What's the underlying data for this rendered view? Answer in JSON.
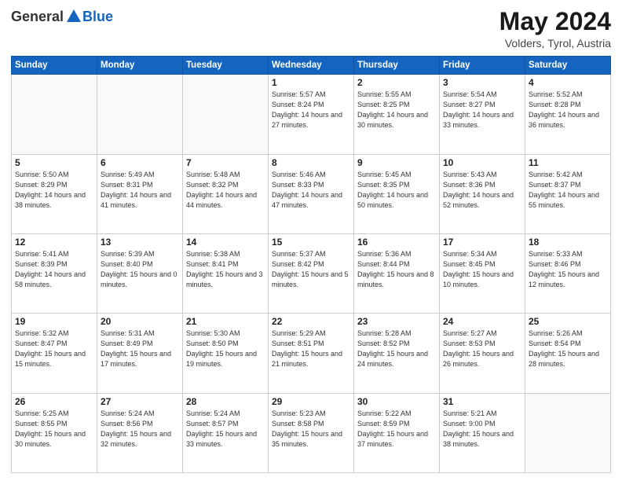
{
  "header": {
    "logo": {
      "general": "General",
      "blue": "Blue"
    },
    "month": "May 2024",
    "location": "Volders, Tyrol, Austria"
  },
  "weekdays": [
    "Sunday",
    "Monday",
    "Tuesday",
    "Wednesday",
    "Thursday",
    "Friday",
    "Saturday"
  ],
  "weeks": [
    [
      {
        "day": "",
        "sunrise": "",
        "sunset": "",
        "daylight": ""
      },
      {
        "day": "",
        "sunrise": "",
        "sunset": "",
        "daylight": ""
      },
      {
        "day": "",
        "sunrise": "",
        "sunset": "",
        "daylight": ""
      },
      {
        "day": "1",
        "sunrise": "Sunrise: 5:57 AM",
        "sunset": "Sunset: 8:24 PM",
        "daylight": "Daylight: 14 hours and 27 minutes."
      },
      {
        "day": "2",
        "sunrise": "Sunrise: 5:55 AM",
        "sunset": "Sunset: 8:25 PM",
        "daylight": "Daylight: 14 hours and 30 minutes."
      },
      {
        "day": "3",
        "sunrise": "Sunrise: 5:54 AM",
        "sunset": "Sunset: 8:27 PM",
        "daylight": "Daylight: 14 hours and 33 minutes."
      },
      {
        "day": "4",
        "sunrise": "Sunrise: 5:52 AM",
        "sunset": "Sunset: 8:28 PM",
        "daylight": "Daylight: 14 hours and 36 minutes."
      }
    ],
    [
      {
        "day": "5",
        "sunrise": "Sunrise: 5:50 AM",
        "sunset": "Sunset: 8:29 PM",
        "daylight": "Daylight: 14 hours and 38 minutes."
      },
      {
        "day": "6",
        "sunrise": "Sunrise: 5:49 AM",
        "sunset": "Sunset: 8:31 PM",
        "daylight": "Daylight: 14 hours and 41 minutes."
      },
      {
        "day": "7",
        "sunrise": "Sunrise: 5:48 AM",
        "sunset": "Sunset: 8:32 PM",
        "daylight": "Daylight: 14 hours and 44 minutes."
      },
      {
        "day": "8",
        "sunrise": "Sunrise: 5:46 AM",
        "sunset": "Sunset: 8:33 PM",
        "daylight": "Daylight: 14 hours and 47 minutes."
      },
      {
        "day": "9",
        "sunrise": "Sunrise: 5:45 AM",
        "sunset": "Sunset: 8:35 PM",
        "daylight": "Daylight: 14 hours and 50 minutes."
      },
      {
        "day": "10",
        "sunrise": "Sunrise: 5:43 AM",
        "sunset": "Sunset: 8:36 PM",
        "daylight": "Daylight: 14 hours and 52 minutes."
      },
      {
        "day": "11",
        "sunrise": "Sunrise: 5:42 AM",
        "sunset": "Sunset: 8:37 PM",
        "daylight": "Daylight: 14 hours and 55 minutes."
      }
    ],
    [
      {
        "day": "12",
        "sunrise": "Sunrise: 5:41 AM",
        "sunset": "Sunset: 8:39 PM",
        "daylight": "Daylight: 14 hours and 58 minutes."
      },
      {
        "day": "13",
        "sunrise": "Sunrise: 5:39 AM",
        "sunset": "Sunset: 8:40 PM",
        "daylight": "Daylight: 15 hours and 0 minutes."
      },
      {
        "day": "14",
        "sunrise": "Sunrise: 5:38 AM",
        "sunset": "Sunset: 8:41 PM",
        "daylight": "Daylight: 15 hours and 3 minutes."
      },
      {
        "day": "15",
        "sunrise": "Sunrise: 5:37 AM",
        "sunset": "Sunset: 8:42 PM",
        "daylight": "Daylight: 15 hours and 5 minutes."
      },
      {
        "day": "16",
        "sunrise": "Sunrise: 5:36 AM",
        "sunset": "Sunset: 8:44 PM",
        "daylight": "Daylight: 15 hours and 8 minutes."
      },
      {
        "day": "17",
        "sunrise": "Sunrise: 5:34 AM",
        "sunset": "Sunset: 8:45 PM",
        "daylight": "Daylight: 15 hours and 10 minutes."
      },
      {
        "day": "18",
        "sunrise": "Sunrise: 5:33 AM",
        "sunset": "Sunset: 8:46 PM",
        "daylight": "Daylight: 15 hours and 12 minutes."
      }
    ],
    [
      {
        "day": "19",
        "sunrise": "Sunrise: 5:32 AM",
        "sunset": "Sunset: 8:47 PM",
        "daylight": "Daylight: 15 hours and 15 minutes."
      },
      {
        "day": "20",
        "sunrise": "Sunrise: 5:31 AM",
        "sunset": "Sunset: 8:49 PM",
        "daylight": "Daylight: 15 hours and 17 minutes."
      },
      {
        "day": "21",
        "sunrise": "Sunrise: 5:30 AM",
        "sunset": "Sunset: 8:50 PM",
        "daylight": "Daylight: 15 hours and 19 minutes."
      },
      {
        "day": "22",
        "sunrise": "Sunrise: 5:29 AM",
        "sunset": "Sunset: 8:51 PM",
        "daylight": "Daylight: 15 hours and 21 minutes."
      },
      {
        "day": "23",
        "sunrise": "Sunrise: 5:28 AM",
        "sunset": "Sunset: 8:52 PM",
        "daylight": "Daylight: 15 hours and 24 minutes."
      },
      {
        "day": "24",
        "sunrise": "Sunrise: 5:27 AM",
        "sunset": "Sunset: 8:53 PM",
        "daylight": "Daylight: 15 hours and 26 minutes."
      },
      {
        "day": "25",
        "sunrise": "Sunrise: 5:26 AM",
        "sunset": "Sunset: 8:54 PM",
        "daylight": "Daylight: 15 hours and 28 minutes."
      }
    ],
    [
      {
        "day": "26",
        "sunrise": "Sunrise: 5:25 AM",
        "sunset": "Sunset: 8:55 PM",
        "daylight": "Daylight: 15 hours and 30 minutes."
      },
      {
        "day": "27",
        "sunrise": "Sunrise: 5:24 AM",
        "sunset": "Sunset: 8:56 PM",
        "daylight": "Daylight: 15 hours and 32 minutes."
      },
      {
        "day": "28",
        "sunrise": "Sunrise: 5:24 AM",
        "sunset": "Sunset: 8:57 PM",
        "daylight": "Daylight: 15 hours and 33 minutes."
      },
      {
        "day": "29",
        "sunrise": "Sunrise: 5:23 AM",
        "sunset": "Sunset: 8:58 PM",
        "daylight": "Daylight: 15 hours and 35 minutes."
      },
      {
        "day": "30",
        "sunrise": "Sunrise: 5:22 AM",
        "sunset": "Sunset: 8:59 PM",
        "daylight": "Daylight: 15 hours and 37 minutes."
      },
      {
        "day": "31",
        "sunrise": "Sunrise: 5:21 AM",
        "sunset": "Sunset: 9:00 PM",
        "daylight": "Daylight: 15 hours and 38 minutes."
      },
      {
        "day": "",
        "sunrise": "",
        "sunset": "",
        "daylight": ""
      }
    ]
  ]
}
